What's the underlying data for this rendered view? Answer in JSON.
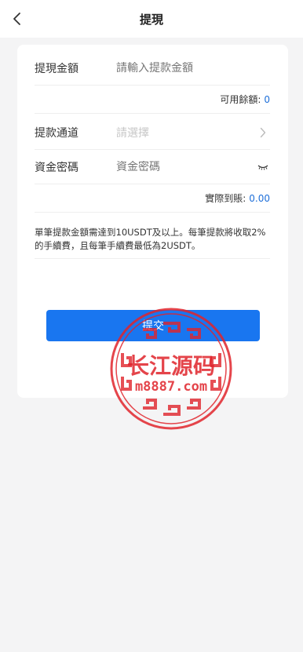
{
  "header": {
    "title": "提現"
  },
  "form": {
    "amount_label": "提現金額",
    "amount_placeholder": "請輸入提款金額",
    "balance_label": "可用餘額:",
    "balance_value": "0",
    "channel_label": "提款通道",
    "channel_placeholder": "請選擇",
    "password_label": "資金密碼",
    "password_placeholder": "資金密碼",
    "actual_label": "實際到賬:",
    "actual_value": "0.00"
  },
  "note": "單筆提款金額需達到10USDT及以上。每筆提款將收取2%的手續費，且每筆手續費最低為2USDT。",
  "submit_label": "提交",
  "watermark": {
    "title": "长江源码",
    "url": "m8887.com"
  },
  "colors": {
    "accent": "#1976f0",
    "value_blue": "#1e6fd9",
    "watermark_red": "#e0242b"
  }
}
